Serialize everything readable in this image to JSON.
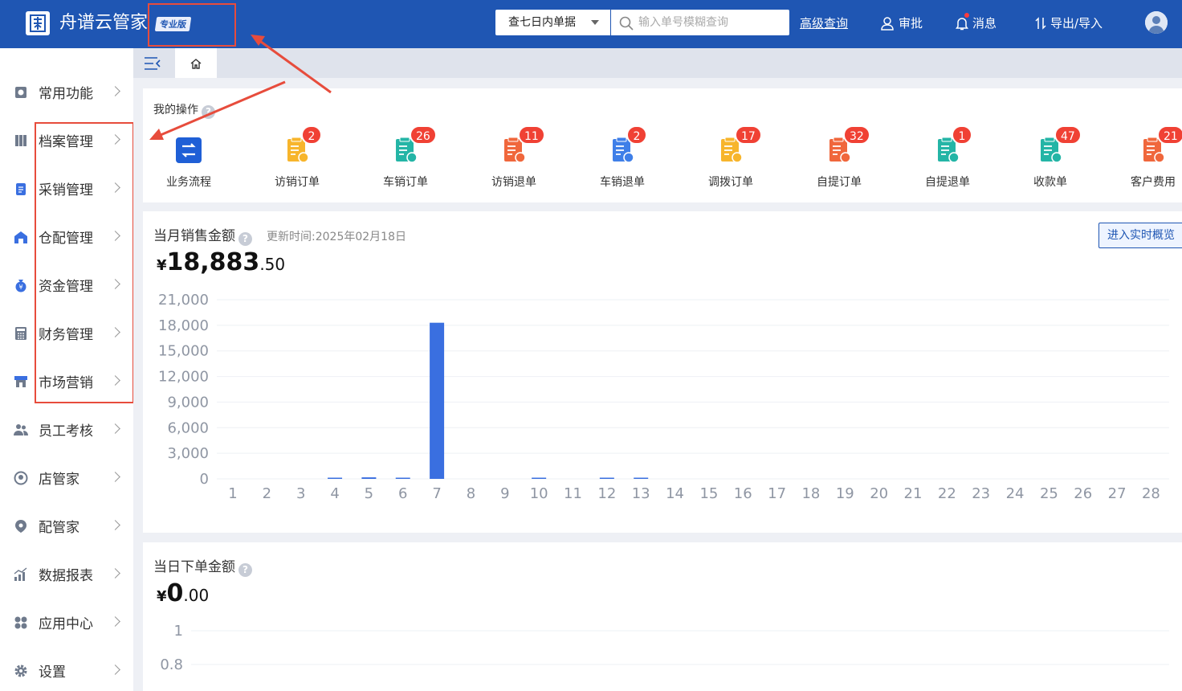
{
  "header": {
    "brand": "舟谱云管家",
    "edition": "专业版",
    "range_select": "查七日内单据",
    "search_placeholder": "输入单号模糊查询",
    "advanced_search": "高级查询",
    "approve": "审批",
    "messages": "消息",
    "export_import": "导出/导入",
    "colors": {
      "header_bg": "#1f56b3",
      "highlight": "#e74c3c"
    }
  },
  "sidebar": {
    "items": [
      {
        "label": "常用功能",
        "icon": "frequent-icon"
      },
      {
        "label": "档案管理",
        "icon": "archive-icon"
      },
      {
        "label": "采销管理",
        "icon": "purchase-icon"
      },
      {
        "label": "仓配管理",
        "icon": "warehouse-icon"
      },
      {
        "label": "资金管理",
        "icon": "money-bag-icon"
      },
      {
        "label": "财务管理",
        "icon": "calculator-icon"
      },
      {
        "label": "市场营销",
        "icon": "store-icon"
      },
      {
        "label": "员工考核",
        "icon": "staff-icon"
      },
      {
        "label": "店管家",
        "icon": "shop-icon"
      },
      {
        "label": "配管家",
        "icon": "delivery-icon"
      },
      {
        "label": "数据报表",
        "icon": "report-icon"
      },
      {
        "label": "应用中心",
        "icon": "apps-icon"
      },
      {
        "label": "设置",
        "icon": "gear-icon"
      }
    ]
  },
  "ops": {
    "title": "我的操作",
    "items": [
      {
        "label": "业务流程",
        "badge": "",
        "color": "#1f5fd6"
      },
      {
        "label": "访销订单",
        "badge": "2",
        "color": "#f7b52c"
      },
      {
        "label": "车销订单",
        "badge": "26",
        "color": "#24b5a6"
      },
      {
        "label": "访销退单",
        "badge": "11",
        "color": "#f0673c"
      },
      {
        "label": "车销退单",
        "badge": "2",
        "color": "#3f7fe8"
      },
      {
        "label": "调拨订单",
        "badge": "17",
        "color": "#f7b52c"
      },
      {
        "label": "自提订单",
        "badge": "32",
        "color": "#f0673c"
      },
      {
        "label": "自提退单",
        "badge": "1",
        "color": "#24b5a6"
      },
      {
        "label": "收款单",
        "badge": "47",
        "color": "#24b5a6"
      },
      {
        "label": "客户费用",
        "badge": "21",
        "color": "#f0673c"
      }
    ]
  },
  "sales": {
    "title": "当月销售金额",
    "update_time": "更新时间:2025年02月18日",
    "currency": "¥",
    "amount_int": "18,883",
    "amount_dec": ".50",
    "realtime_button": "进入实时概览"
  },
  "today": {
    "title": "当日下单金额",
    "currency": "¥",
    "amount_int": "0",
    "amount_dec": ".00"
  },
  "chart_data": [
    {
      "type": "bar",
      "categories": [
        "1",
        "2",
        "3",
        "4",
        "5",
        "6",
        "7",
        "8",
        "9",
        "10",
        "11",
        "12",
        "13",
        "14",
        "15",
        "16",
        "17",
        "18",
        "19",
        "20",
        "21",
        "22",
        "23",
        "24",
        "25",
        "26",
        "27",
        "28"
      ],
      "values": [
        0,
        0,
        0,
        60,
        180,
        70,
        18300,
        0,
        0,
        60,
        0,
        70,
        120,
        0,
        0,
        0,
        0,
        0,
        0,
        0,
        0,
        0,
        0,
        0,
        0,
        0,
        0,
        0
      ],
      "yticks": [
        "21,000",
        "18,000",
        "15,000",
        "12,000",
        "9,000",
        "6,000",
        "3,000",
        "0"
      ],
      "ylim": [
        0,
        21000
      ],
      "grid": true,
      "color": "#3a6fe0"
    },
    {
      "type": "bar",
      "categories": [],
      "values": [],
      "yticks": [
        "1",
        "0.8"
      ],
      "ylim": [
        0,
        1
      ],
      "grid": true,
      "color": "#3a6fe0"
    }
  ]
}
